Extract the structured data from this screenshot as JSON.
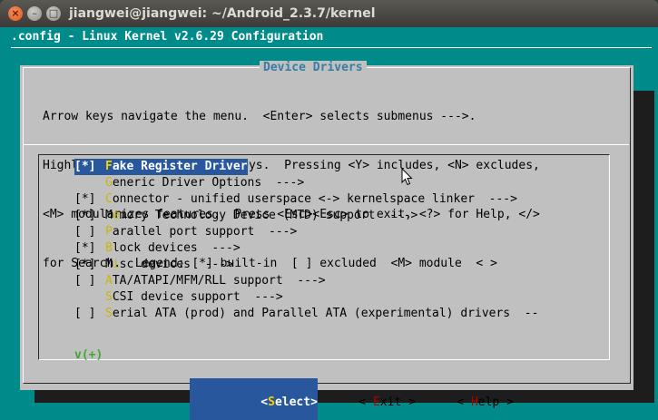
{
  "window": {
    "title": "jiangwei@jiangwei: ~/Android_2.3.7/kernel",
    "close_glyph": "×",
    "min_glyph": "–",
    "max_glyph": "□"
  },
  "config_title": ".config - Linux Kernel v2.6.29 Configuration",
  "dialog": {
    "title": "Device Drivers",
    "help_lines": [
      "Arrow keys navigate the menu.  <Enter> selects submenus --->.",
      "Highlighted letters are hotkeys.  Pressing <Y> includes, <N> excludes,",
      "<M> modularizes features.  Press <Esc><Esc> to exit, <?> for Help, </>",
      "for Search.  Legend: [*] built-in  [ ] excluded  <M> module  < >"
    ],
    "items": [
      {
        "mark": "[*]",
        "hotkey": "F",
        "rest": "ake Register Driver",
        "selected": true
      },
      {
        "mark": "   ",
        "hotkey": "G",
        "rest": "eneric Driver Options  --->",
        "selected": false
      },
      {
        "mark": "[*]",
        "hotkey": "C",
        "rest": "onnector - unified userspace <-> kernelspace linker  --->",
        "selected": false
      },
      {
        "mark": "[*]",
        "hotkey": "",
        "pre": "M",
        "hotkey2": "e",
        "rest": "mory Technology Device (MTD) support  --->",
        "selected": false
      },
      {
        "mark": "[ ]",
        "hotkey": "P",
        "rest": "arallel port support  --->",
        "selected": false
      },
      {
        "mark": "[*]",
        "hotkey": "B",
        "rest": "lock devices  --->",
        "selected": false
      },
      {
        "mark": "[*]",
        "hotkey": "",
        "pre": "M",
        "hotkey2": "i",
        "rest": "sc devices  --->",
        "selected": false
      },
      {
        "mark": "[ ]",
        "hotkey": "A",
        "rest": "TA/ATAPI/MFM/RLL support  --->",
        "selected": false
      },
      {
        "mark": "   ",
        "hotkey": "S",
        "rest": "CSI device support  --->",
        "selected": false
      },
      {
        "mark": "[ ]",
        "hotkey": "S",
        "rest": "erial ATA (prod) and Parallel ATA (experimental) drivers  --",
        "selected": false
      }
    ],
    "more_indicator": "v(+)",
    "buttons": {
      "select": {
        "open": "<",
        "hotkey": "S",
        "rest": "elect",
        "close": ">"
      },
      "exit": {
        "open": "< ",
        "hotkey": "E",
        "rest": "xit",
        "close": " >"
      },
      "help": {
        "open": "< ",
        "hotkey": "H",
        "rest": "elp",
        "close": " >"
      }
    }
  },
  "colors": {
    "terminal_bg": "#008b8b",
    "dialog_bg": "#c0c0c0",
    "selection": "#28579d",
    "title_text": "#3a7ca5"
  }
}
